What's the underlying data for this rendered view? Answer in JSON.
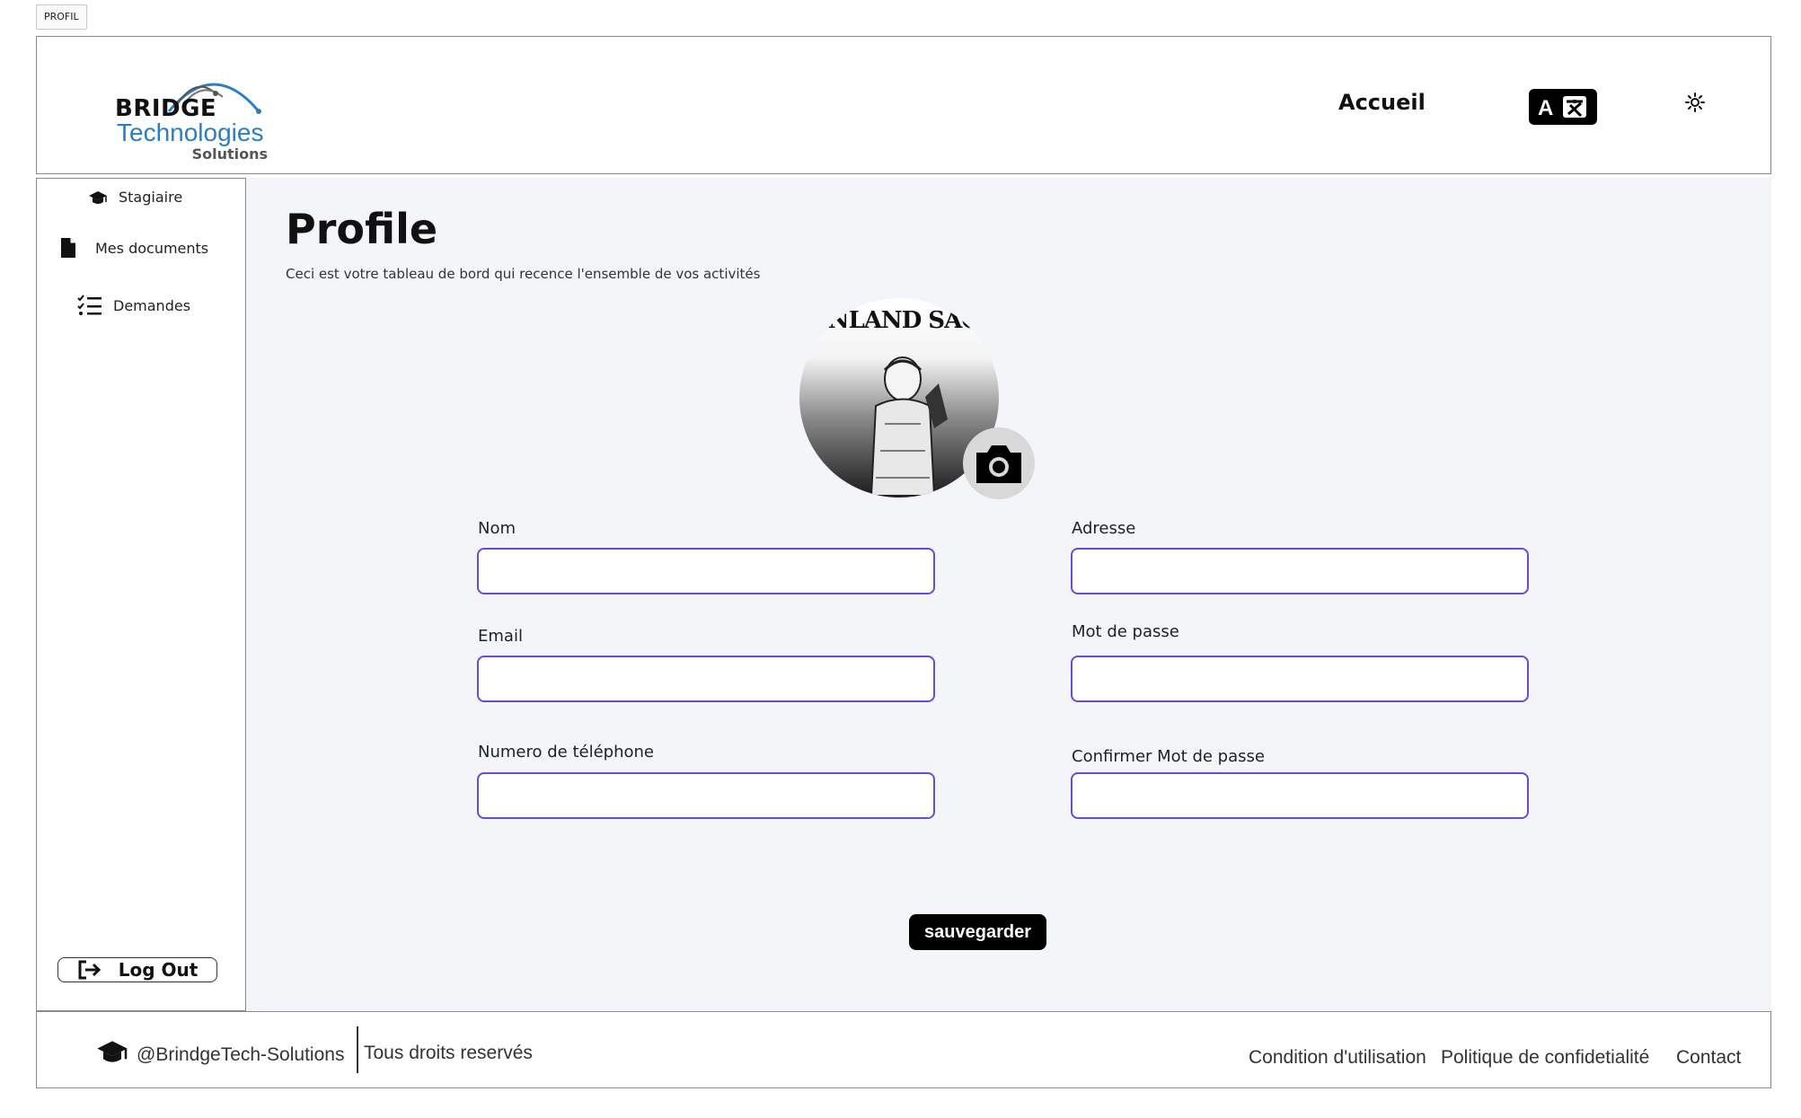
{
  "tag": {
    "label": "PROFIL"
  },
  "logo": {
    "word1": "BRIDGE",
    "word2": "Technologies",
    "word3": "Solutions"
  },
  "header": {
    "nav_home": "Accueil",
    "lang_icon": "translate-icon",
    "theme_icon": "sun-icon"
  },
  "sidebar": {
    "items": [
      {
        "label": "Stagiaire",
        "icon": "graduation-cap-icon"
      },
      {
        "label": "Mes documents",
        "icon": "document-icon"
      },
      {
        "label": "Demandes",
        "icon": "checklist-icon"
      }
    ],
    "logout": {
      "label": "Log Out",
      "icon": "logout-icon"
    }
  },
  "main": {
    "title": "Profile",
    "subtitle": "Ceci est votre tableau de bord qui recence l'ensemble de vos activités",
    "avatar_caption": "VINLAND SAGA",
    "fields": {
      "nom": {
        "label": "Nom",
        "value": ""
      },
      "adresse": {
        "label": "Adresse",
        "value": ""
      },
      "email": {
        "label": "Email",
        "value": ""
      },
      "password": {
        "label": "Mot de passe",
        "value": ""
      },
      "phone": {
        "label": "Numero de téléphone",
        "value": ""
      },
      "confirm": {
        "label": "Confirmer Mot de passe",
        "value": ""
      }
    },
    "save_label": "sauvegarder"
  },
  "footer": {
    "handle": "@BrindgeTech-Solutions",
    "rights": "Tous droits reservés",
    "links": [
      "Condition d'utilisation",
      "Politique de confidetialité",
      "Contact"
    ]
  },
  "colors": {
    "input_border": "#6a4bd8",
    "logo_blue": "#2a7fc3",
    "main_bg": "#f3f5f8"
  }
}
